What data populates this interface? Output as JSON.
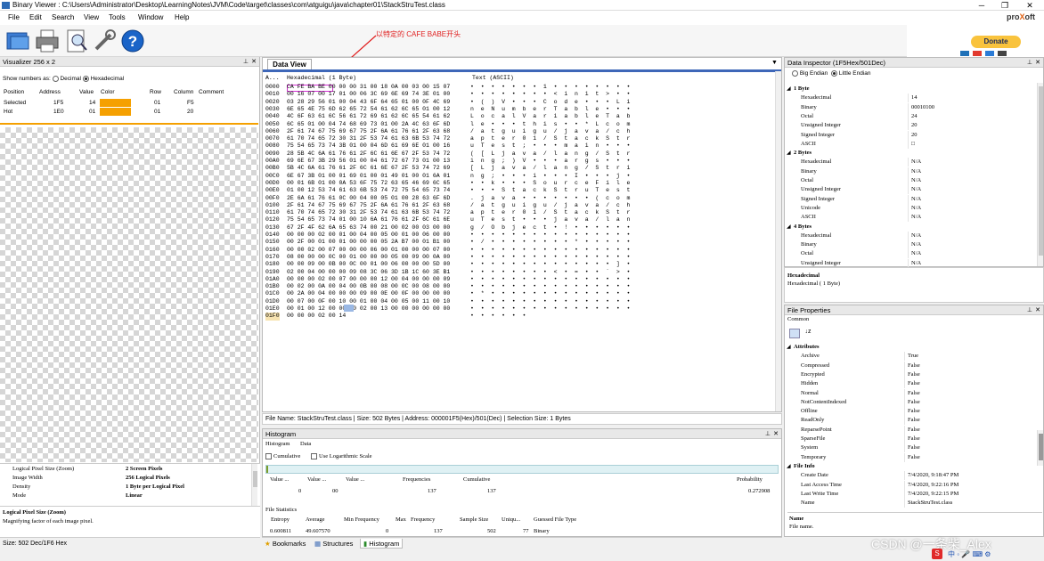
{
  "window": {
    "title": "Binary Viewer : C:\\Users\\Administrator\\Desktop\\LearningNotes\\JVM\\Code\\target\\classes\\com\\atguigu\\java\\chapter01\\StackStruTest.class",
    "brand_pro": "pro",
    "brand_x": "X",
    "brand_oft": "oft"
  },
  "menu": [
    "File",
    "Edit",
    "Search",
    "View",
    "Tools",
    "Window",
    "Help"
  ],
  "toolbar": {
    "icons": [
      "open-folder-icon",
      "print-icon",
      "print-preview-icon",
      "tools-icon",
      "help-icon"
    ],
    "donate_label": "Donate"
  },
  "annotation": "以特定的 CAFE BABE开头",
  "visualizer": {
    "header": "Visualizer 256 x 2",
    "show_numbers_as": "Show numbers as:",
    "decimal": "Decimal",
    "hexadecimal": "Hexadecimal",
    "columns": [
      "Position",
      "Address",
      "Value",
      "Color",
      "Row",
      "Column",
      "Comment"
    ],
    "rows": [
      {
        "position": "Selected",
        "address": "1F5",
        "value": "14",
        "row": "01",
        "column": "F5"
      },
      {
        "position": "Hot",
        "address": "1E0",
        "value": "01",
        "row": "01",
        "column": "20"
      }
    ],
    "accent_color": "#f5a000",
    "props": [
      {
        "k": "Logical Pixel Size (Zoom)",
        "v": "2 Screen Pixels"
      },
      {
        "k": "Image Width",
        "v": "256 Logical Pixels"
      },
      {
        "k": "Density",
        "v": "1 Byte per Logical Pixel"
      },
      {
        "k": "Mode",
        "v": "Linear"
      }
    ],
    "desc_title": "Logical Pixel Size (Zoom)",
    "desc_text": "Magnifying factor of each image pixel.",
    "status": "Size: 502 Dec/1F6 Hex"
  },
  "dataview": {
    "tab": "Data View",
    "col_addr": "A...",
    "col_hex": "Hexadecimal (1 Byte)",
    "col_text": "Text (ASCII)",
    "lines": [
      {
        "a": "0000",
        "h": "CA FE BA BE 00 00 00 31 00 18 0A 00 03 00 15 07",
        "t": "•  •  •  •  •  •  •  1  •  •  •  •  •  •  •  •"
      },
      {
        "a": "0010",
        "h": "00 16 07 00 17 01 00 06 3C 69 6E 69 74 3E 01 00",
        "t": "•  •  •  •  •  •  •  •  <  i  n  i  t  >  •  •"
      },
      {
        "a": "0020",
        "h": "03 28 29 56 01 00 04 43 6F 64 65 01 00 0F 4C 69",
        "t": "•  (  )  V  •  •  •  C  o  d  e  •  •  •  L  i"
      },
      {
        "a": "0030",
        "h": "6E 65 4E 75 6D 62 65 72 54 61 62 6C 65 01 00 12",
        "t": "n  e  N  u  m  b  e  r  T  a  b  l  e  •  •  •"
      },
      {
        "a": "0040",
        "h": "4C 6F 63 61 6C 56 61 72 69 61 62 6C 65 54 61 62",
        "t": "L  o  c  a  l  V  a  r  i  a  b  l  e  T  a  b"
      },
      {
        "a": "0050",
        "h": "6C 65 01 00 04 74 68 69 73 01 00 2A 4C 63 6F 6D",
        "t": "l  e  •  •  •  t  h  i  s  •  •  *  L  c  o  m"
      },
      {
        "a": "0060",
        "h": "2F 61 74 67 75 69 67 75 2F 6A 61 76 61 2F 63 68",
        "t": "/  a  t  g  u  i  g  u  /  j  a  v  a  /  c  h"
      },
      {
        "a": "0070",
        "h": "61 70 74 65 72 30 31 2F 53 74 61 63 6B 53 74 72",
        "t": "a  p  t  e  r  0  1  /  S  t  a  c  k  S  t  r"
      },
      {
        "a": "0080",
        "h": "75 54 65 73 74 3B 01 00 04 6D 61 69 6E 01 00 16",
        "t": "u  T  e  s  t  ;  •  •  •  m  a  i  n  •  •  •"
      },
      {
        "a": "0090",
        "h": "28 5B 4C 6A 61 76 61 2F 6C 61 6E 67 2F 53 74 72",
        "t": "(  [  L  j  a  v  a  /  l  a  n  g  /  S  t  r"
      },
      {
        "a": "00A0",
        "h": "69 6E 67 3B 29 56 01 00 04 61 72 67 73 01 00 13",
        "t": "i  n  g  ;  )  V  •  •  •  a  r  g  s  •  •  •"
      },
      {
        "a": "00B0",
        "h": "5B 4C 6A 61 76 61 2F 6C 61 6E 67 2F 53 74 72 69",
        "t": "[  L  j  a  v  a  /  l  a  n  g  /  S  t  r  i"
      },
      {
        "a": "00C0",
        "h": "6E 67 3B 01 00 01 69 01 00 01 49 01 00 01 6A 01",
        "t": "n  g  ;  •  •  •  i  •  •  •  I  •  •  •  j  •"
      },
      {
        "a": "00D0",
        "h": "00 01 6B 01 00 0A 53 6F 75 72 63 65 46 69 6C 65",
        "t": "•  •  k  •  •  •  S  o  u  r  c  e  F  i  l  e"
      },
      {
        "a": "00E0",
        "h": "01 00 12 53 74 61 63 6B 53 74 72 75 54 65 73 74",
        "t": "•  •  •  S  t  a  c  k  S  t  r  u  T  e  s  t"
      },
      {
        "a": "00F0",
        "h": "2E 6A 61 76 61 0C 00 04 00 05 01 00 28 63 6F 6D",
        "t": ".  j  a  v  a  •  •  •  •  •  •  •  (  c  o  m"
      },
      {
        "a": "0100",
        "h": "2F 61 74 67 75 69 67 75 2F 6A 61 76 61 2F 63 68",
        "t": "/  a  t  g  u  i  g  u  /  j  a  v  a  /  c  h"
      },
      {
        "a": "0110",
        "h": "61 70 74 65 72 30 31 2F 53 74 61 63 6B 53 74 72",
        "t": "a  p  t  e  r  0  1  /  S  t  a  c  k  S  t  r"
      },
      {
        "a": "0120",
        "h": "75 54 65 73 74 01 00 10 6A 61 76 61 2F 6C 61 6E",
        "t": "u  T  e  s  t  •  •  •  j  a  v  a  /  l  a  n"
      },
      {
        "a": "0130",
        "h": "67 2F 4F 62 6A 65 63 74 00 21 00 02 00 03 00 00",
        "t": "g  /  O  b  j  e  c  t  •  !  •  •  •  •  •  •"
      },
      {
        "a": "0140",
        "h": "00 00 00 02 00 01 00 04 00 05 00 01 00 06 00 00",
        "t": "•  •  •  •  •  •  •  •  •  •  •  •  •  •  •  •"
      },
      {
        "a": "0150",
        "h": "00 2F 00 01 00 01 00 00 00 05 2A B7 00 01 B1 00",
        "t": "•  /  •  •  •  •  •  •  •  •  *  •  •  •  •  •"
      },
      {
        "a": "0160",
        "h": "00 00 02 00 07 00 00 00 06 00 01 00 00 00 07 00",
        "t": "•  •  •  •  •  •  •  •  •  •  •  •  •  •  •  •"
      },
      {
        "a": "0170",
        "h": "08 00 00 00 0C 00 01 00 00 00 05 00 09 00 0A 00",
        "t": "•  •  •  •  •  •  •  •  •  •  •  •  •  •  •  •"
      },
      {
        "a": "0180",
        "h": "00 00 09 00 0B 00 0C 00 01 00 06 00 00 00 5D 00",
        "t": "•  •  •  •  •  •  •  •  •  •  •  •  •  •  ]  •"
      },
      {
        "a": "0190",
        "h": "02 00 04 00 00 00 09 08 3C 06 3D 1B 1C 60 3E B1",
        "t": "•  •  •  •  •  •  •  •  <  •  =  •  •  `  >  •"
      },
      {
        "a": "01A0",
        "h": "00 00 00 02 00 07 00 00 00 12 00 04 00 00 00 09",
        "t": "•  •  •  •  •  •  •  •  •  •  •  •  •  •  •  •"
      },
      {
        "a": "01B0",
        "h": "00 02 00 0A 00 04 00 0B 00 08 00 0C 00 08 00 00",
        "t": "•  •  •  •  •  •  •  •  •  •  •  •  •  •  •  •"
      },
      {
        "a": "01C0",
        "h": "00 2A 00 04 00 00 00 09 00 0E 00 0F 00 00 00 00",
        "t": "•  *  •  •  •  •  •  •  •  •  •  •  •  •  •  •"
      },
      {
        "a": "01D0",
        "h": "00 07 00 0F 00 10 00 01 00 04 00 05 00 11 00 10",
        "t": "•  •  •  •  •  •  •  •  •  •  •  •  •  •  •  •"
      },
      {
        "a": "01E0",
        "h": "00 01 00 12 00 00 00 02 00 13 00 00 00 00 00 00",
        "t": "•  •  •  •  •  •  •  •  •  •  •  •  •  •  •  •"
      },
      {
        "a": "01F0",
        "h": "00 00 00 02 00 14",
        "t": "•  •  •  •  •  •"
      }
    ],
    "status": "File Name: StackStruTest.class  |  Size: 502 Bytes  |  Address: 000001F5(Hex)/501(Dec)  |  Selection Size: 1 Bytes"
  },
  "histogram": {
    "header": "Histogram",
    "tabs": [
      "Histogram",
      "Data"
    ],
    "cumulative": "Cumulative",
    "log_scale": "Use Logarithmic Scale",
    "table_cols": [
      "Value ...",
      "Value ...",
      "Value ...",
      "Frequencies",
      "Cumulative",
      "Probability"
    ],
    "table_vals": [
      "0",
      "00",
      "",
      "137",
      "137",
      "0.272908"
    ],
    "stats_title": "File Statistics",
    "stats_cols": [
      "Entropy",
      "Average",
      "Min Frequency",
      "Max",
      "Frequency",
      "Sample Size",
      "Uniqu...",
      "Guessed File Type"
    ],
    "stats_vals": [
      "0.600811",
      "49.607570",
      "0",
      "",
      "137",
      "502",
      "77",
      "Binary"
    ],
    "bottom_tabs": [
      "Bookmarks",
      "Structures",
      "Histogram"
    ]
  },
  "inspector": {
    "header": "Data Inspector (1F5Hex/501Dec)",
    "big_endian": "Big Endian",
    "little_endian": "Little Endian",
    "rows": [
      {
        "k": "1 Byte",
        "v": "",
        "sect": true
      },
      {
        "k": "Hexadecimal",
        "v": "14"
      },
      {
        "k": "Binary",
        "v": "00010100"
      },
      {
        "k": "Octal",
        "v": "24"
      },
      {
        "k": "Unsigned Integer",
        "v": "20"
      },
      {
        "k": "Signed Integer",
        "v": "20"
      },
      {
        "k": "ASCII",
        "v": "□"
      },
      {
        "k": "2 Bytes",
        "v": "",
        "sect": true
      },
      {
        "k": "Hexadecimal",
        "v": "N/A"
      },
      {
        "k": "Binary",
        "v": "N/A"
      },
      {
        "k": "Octal",
        "v": "N/A"
      },
      {
        "k": "Unsigned Integer",
        "v": "N/A"
      },
      {
        "k": "Signed Integer",
        "v": "N/A"
      },
      {
        "k": "Unicode",
        "v": "N/A"
      },
      {
        "k": "ASCII",
        "v": "N/A"
      },
      {
        "k": "4 Bytes",
        "v": "",
        "sect": true
      },
      {
        "k": "Hexadecimal",
        "v": "N/A"
      },
      {
        "k": "Binary",
        "v": "N/A"
      },
      {
        "k": "Octal",
        "v": "N/A"
      },
      {
        "k": "Unsigned Integer",
        "v": "N/A"
      }
    ],
    "desc_title": "Hexadecimal",
    "desc_text": "Hexadecimal ( 1 Byte)"
  },
  "file_props": {
    "header": "File Properties",
    "common": "Common",
    "rows": [
      {
        "k": "Attributes",
        "v": "",
        "sect": true
      },
      {
        "k": "Archive",
        "v": "True"
      },
      {
        "k": "Compressed",
        "v": "False"
      },
      {
        "k": "Encrypted",
        "v": "False"
      },
      {
        "k": "Hidden",
        "v": "False"
      },
      {
        "k": "Normal",
        "v": "False"
      },
      {
        "k": "NotContentIndexed",
        "v": "False"
      },
      {
        "k": "Offline",
        "v": "False"
      },
      {
        "k": "ReadOnly",
        "v": "False"
      },
      {
        "k": "ReparsePoint",
        "v": "False"
      },
      {
        "k": "SparseFile",
        "v": "False"
      },
      {
        "k": "System",
        "v": "False"
      },
      {
        "k": "Temporary",
        "v": "False"
      },
      {
        "k": "File Info",
        "v": "",
        "sect": true
      },
      {
        "k": "Create Date",
        "v": "7/4/2020, 9:18:47 PM"
      },
      {
        "k": "Last Access Time",
        "v": "7/4/2020, 9:22:16 PM"
      },
      {
        "k": "Last Write Time",
        "v": "7/4/2020, 9:22:15 PM"
      },
      {
        "k": "Name",
        "v": "StackStruTest.class"
      }
    ],
    "desc_title": "Name",
    "desc_text": "File name."
  },
  "watermark": "CSDN @一条柴_Alex"
}
